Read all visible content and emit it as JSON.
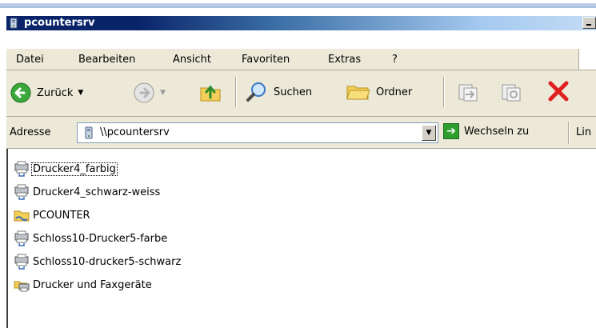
{
  "window": {
    "title": "pcountersrv"
  },
  "menu": [
    {
      "label": "Datei"
    },
    {
      "label": "Bearbeiten"
    },
    {
      "label": "Ansicht"
    },
    {
      "label": "Favoriten"
    },
    {
      "label": "Extras"
    },
    {
      "label": "?"
    }
  ],
  "toolbar": {
    "back_label": "Zurück",
    "search_label": "Suchen",
    "folders_label": "Ordner"
  },
  "address": {
    "label": "Adresse",
    "value": "\\\\pcountersrv",
    "go_label": "Wechseln zu",
    "links_label": "Lin"
  },
  "items": [
    {
      "label": "Drucker4_farbig",
      "icon": "network-printer-icon"
    },
    {
      "label": "Drucker4_schwarz-weiss",
      "icon": "network-printer-icon"
    },
    {
      "label": "PCOUNTER",
      "icon": "shared-folder-icon"
    },
    {
      "label": "Schloss10-Drucker5-farbe",
      "icon": "network-printer-icon"
    },
    {
      "label": "Schloss10-drucker5-schwarz",
      "icon": "network-printer-icon"
    },
    {
      "label": "Drucker und Faxgeräte",
      "icon": "printers-and-faxes-icon"
    }
  ],
  "colors": {
    "title_active": "#0a246a",
    "chrome": "#ece9d8",
    "go_green": "#2e9e2e",
    "delete_red": "#e02020"
  }
}
